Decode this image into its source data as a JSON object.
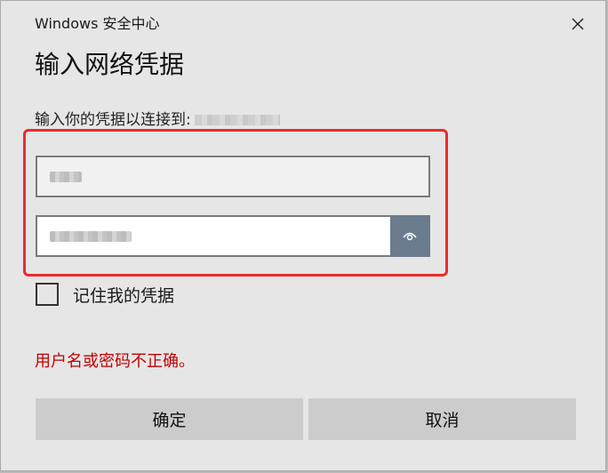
{
  "window": {
    "title": "Windows 安全中心",
    "close_icon": "close-icon"
  },
  "dialog": {
    "heading": "输入网络凭据",
    "prompt": "输入你的凭据以连接到:"
  },
  "fields": {
    "username_value": "user",
    "password_value": "password",
    "reveal_icon": "eye-icon"
  },
  "remember": {
    "label": "记住我的凭据",
    "checked": false
  },
  "error": {
    "message": "用户名或密码不正确。"
  },
  "buttons": {
    "ok_label": "确定",
    "cancel_label": "取消"
  },
  "colors": {
    "error": "#c40000",
    "highlight": "#ef2a2a",
    "reveal_button": "#6b7c8e"
  }
}
